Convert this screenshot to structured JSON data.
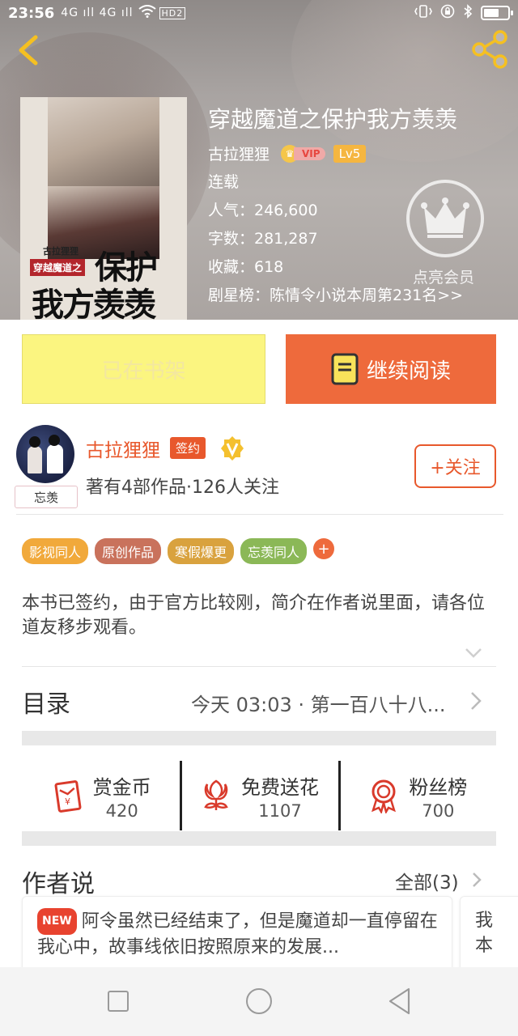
{
  "status_bar": {
    "time": "23:56",
    "signal": "4G ıll 4G ıll",
    "network": "HD2"
  },
  "book": {
    "title": "穿越魔道之保护我方羡羡",
    "author": "古拉狸狸",
    "vip_label": "VIP",
    "level": "Lv5",
    "status": "连载",
    "popularity": "人气：246,600",
    "word_count": "字数：281,287",
    "favorites": "收藏：618",
    "ranking": "剧星榜：陈情令小说本周第231名>>",
    "member_label": "点亮会员",
    "cover": {
      "author_small": "古拉狸狸",
      "tag": "穿越魔道之",
      "title_line1": "保护",
      "title_line2": "我方羡羡"
    }
  },
  "actions": {
    "shelf_label": "已在书架",
    "read_label": "继续阅读"
  },
  "author": {
    "name": "古拉狸狸",
    "sign_badge": "签约",
    "avatar_tag": "忘羡",
    "stats": "著有4部作品·126人关注",
    "follow_label": "+关注"
  },
  "tags": [
    {
      "label": "影视同人",
      "color": "#f1a93b"
    },
    {
      "label": "原创作品",
      "color": "#c9725c"
    },
    {
      "label": "寒假爆更",
      "color": "#d9a23e"
    },
    {
      "label": "忘羡同人",
      "color": "#8bb857"
    }
  ],
  "tag_add": "+",
  "intro": "本书已签约，由于官方比较刚，简介在作者说里面，请各位道友移步观看。",
  "toc": {
    "label": "目录",
    "latest": "今天 03:03 · 第一百八十八..."
  },
  "stats": [
    {
      "label": "赏金币",
      "value": "420",
      "icon": "red-envelope-icon"
    },
    {
      "label": "免费送花",
      "value": "1107",
      "icon": "flower-icon"
    },
    {
      "label": "粉丝榜",
      "value": "700",
      "icon": "medal-icon"
    }
  ],
  "sayings": {
    "title": "作者说",
    "all_label": "全部(3)",
    "new_badge": "NEW",
    "card1_text": "阿令虽然已经结束了，但是魔道却一直停留在我心中，故事线依旧按照原来的发展...",
    "card2_text": "我本"
  },
  "colors": {
    "accent": "#e8582c",
    "read_button": "#ee6a3c",
    "shelf_button": "#fbf580"
  }
}
